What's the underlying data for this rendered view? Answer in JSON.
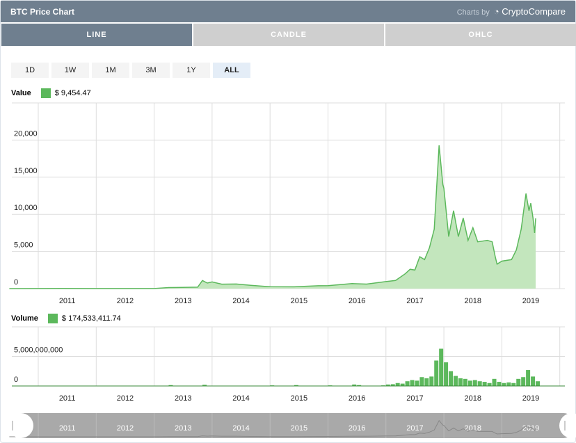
{
  "header": {
    "title": "BTC Price Chart",
    "charts_by": "Charts by",
    "brand": "CryptoCompare"
  },
  "tabs": [
    {
      "label": "LINE",
      "active": true
    },
    {
      "label": "CANDLE",
      "active": false
    },
    {
      "label": "OHLC",
      "active": false
    }
  ],
  "ranges": [
    {
      "label": "1D"
    },
    {
      "label": "1W"
    },
    {
      "label": "1M"
    },
    {
      "label": "3M"
    },
    {
      "label": "1Y"
    },
    {
      "label": "ALL",
      "active": true
    }
  ],
  "colors": {
    "series": "#5cb85c",
    "fill": "#c3e6bd",
    "header": "#6f7f8f",
    "navigator": "#a9a9a9"
  },
  "chart_data": [
    {
      "type": "area",
      "label": "Value",
      "readout": "$ 9,454.47",
      "ylim": [
        0,
        25000
      ],
      "yticks": [
        "0",
        "5,000",
        "10,000",
        "15,000",
        "20,000"
      ],
      "ytick_values": [
        0,
        5000,
        10000,
        15000,
        20000
      ],
      "xticks": [
        "2011",
        "2012",
        "2013",
        "2014",
        "2015",
        "2016",
        "2017",
        "2018",
        "2019"
      ],
      "xlim": [
        "2010-07",
        "2019-08"
      ],
      "grid": true,
      "points": [
        [
          "2010-07",
          0.1
        ],
        [
          "2011-06",
          15
        ],
        [
          "2012-01",
          6
        ],
        [
          "2013-01",
          13
        ],
        [
          "2013-04",
          140
        ],
        [
          "2013-10",
          200
        ],
        [
          "2013-11",
          1100
        ],
        [
          "2013-12",
          750
        ],
        [
          "2014-01",
          900
        ],
        [
          "2014-03",
          600
        ],
        [
          "2014-06",
          620
        ],
        [
          "2014-09",
          450
        ],
        [
          "2015-01",
          250
        ],
        [
          "2015-06",
          240
        ],
        [
          "2015-11",
          380
        ],
        [
          "2016-01",
          400
        ],
        [
          "2016-06",
          670
        ],
        [
          "2016-09",
          610
        ],
        [
          "2017-01",
          950
        ],
        [
          "2017-03",
          1100
        ],
        [
          "2017-05",
          2000
        ],
        [
          "2017-06",
          2600
        ],
        [
          "2017-07",
          2500
        ],
        [
          "2017-08",
          4300
        ],
        [
          "2017-09",
          3900
        ],
        [
          "2017-10",
          5500
        ],
        [
          "2017-11",
          8000
        ],
        [
          "2017-12",
          19300
        ],
        [
          "2017-12-25",
          14000
        ],
        [
          "2018-01",
          13500
        ],
        [
          "2018-02",
          7000
        ],
        [
          "2018-03",
          10500
        ],
        [
          "2018-04",
          7000
        ],
        [
          "2018-05",
          9500
        ],
        [
          "2018-06",
          6500
        ],
        [
          "2018-07",
          8200
        ],
        [
          "2018-08",
          6300
        ],
        [
          "2018-10",
          6500
        ],
        [
          "2018-11",
          6300
        ],
        [
          "2018-11-20",
          4300
        ],
        [
          "2018-12",
          3300
        ],
        [
          "2019-01",
          3700
        ],
        [
          "2019-03",
          3900
        ],
        [
          "2019-04",
          5200
        ],
        [
          "2019-05",
          8000
        ],
        [
          "2019-06",
          12800
        ],
        [
          "2019-06-20",
          10500
        ],
        [
          "2019-07",
          11500
        ],
        [
          "2019-07-15",
          9500
        ],
        [
          "2019-07-25",
          7500
        ],
        [
          "2019-08",
          9454.47
        ]
      ]
    },
    {
      "type": "bar",
      "label": "Volume",
      "readout": "$ 174,533,411.74",
      "ylim": [
        0,
        10000000000
      ],
      "yticks": [
        "0",
        "5,000,000,000"
      ],
      "ytick_values": [
        0,
        5000000000
      ],
      "xticks": [
        "2011",
        "2012",
        "2013",
        "2014",
        "2015",
        "2016",
        "2017",
        "2018",
        "2019"
      ],
      "grid": true,
      "points": [
        [
          "2013-04",
          150000000
        ],
        [
          "2013-11",
          200000000
        ],
        [
          "2015-01",
          100000000
        ],
        [
          "2015-06",
          150000000
        ],
        [
          "2016-01",
          100000000
        ],
        [
          "2016-06",
          250000000
        ],
        [
          "2016-07",
          150000000
        ],
        [
          "2016-12",
          100000000
        ],
        [
          "2017-01",
          250000000
        ],
        [
          "2017-02",
          300000000
        ],
        [
          "2017-03",
          500000000
        ],
        [
          "2017-04",
          400000000
        ],
        [
          "2017-05",
          800000000
        ],
        [
          "2017-06",
          1000000000
        ],
        [
          "2017-07",
          900000000
        ],
        [
          "2017-08",
          1500000000
        ],
        [
          "2017-09",
          1300000000
        ],
        [
          "2017-10",
          1600000000
        ],
        [
          "2017-11",
          4300000000
        ],
        [
          "2017-12",
          6300000000
        ],
        [
          "2018-01",
          4000000000
        ],
        [
          "2018-02",
          2500000000
        ],
        [
          "2018-03",
          1700000000
        ],
        [
          "2018-04",
          1300000000
        ],
        [
          "2018-05",
          1200000000
        ],
        [
          "2018-06",
          900000000
        ],
        [
          "2018-07",
          1000000000
        ],
        [
          "2018-08",
          800000000
        ],
        [
          "2018-09",
          700000000
        ],
        [
          "2018-10",
          500000000
        ],
        [
          "2018-11",
          1200000000
        ],
        [
          "2018-12",
          700000000
        ],
        [
          "2019-01",
          500000000
        ],
        [
          "2019-02",
          600000000
        ],
        [
          "2019-03",
          500000000
        ],
        [
          "2019-04",
          1200000000
        ],
        [
          "2019-05",
          1500000000
        ],
        [
          "2019-06",
          2700000000
        ],
        [
          "2019-07",
          1600000000
        ],
        [
          "2019-08",
          800000000
        ]
      ]
    },
    {
      "type": "navigator",
      "xticks": [
        "2011",
        "2012",
        "2013",
        "2014",
        "2015",
        "2016",
        "2017",
        "2018",
        "2019"
      ]
    }
  ]
}
